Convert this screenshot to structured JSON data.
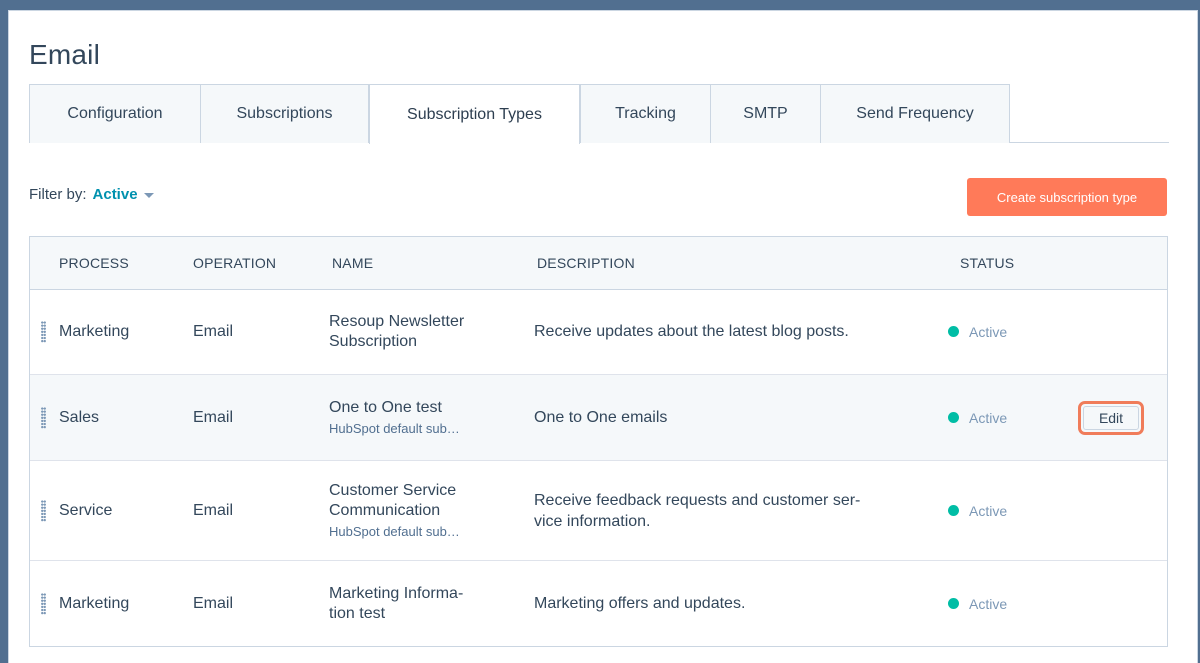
{
  "page": {
    "title": "Email"
  },
  "tabs": [
    {
      "label": "Configuration"
    },
    {
      "label": "Subscriptions"
    },
    {
      "label": "Subscription Types"
    },
    {
      "label": "Tracking"
    },
    {
      "label": "SMTP"
    },
    {
      "label": "Send Frequency"
    }
  ],
  "active_tab": "Subscription Types",
  "filter": {
    "label": "Filter by:",
    "value": "Active"
  },
  "actions": {
    "create_label": "Create subscription type"
  },
  "table": {
    "columns": [
      "PROCESS",
      "OPERATION",
      "NAME",
      "DESCRIPTION",
      "STATUS"
    ],
    "rows": [
      {
        "process": "Marketing",
        "operation": "Email",
        "name": "Resoup Newsletter Subscription",
        "subtitle": "",
        "description": "Receive updates about the latest blog posts.",
        "status": "Active"
      },
      {
        "process": "Sales",
        "operation": "Email",
        "name": "One to One test",
        "subtitle": "HubSpot default sub…",
        "description": "One to One emails",
        "status": "Active",
        "edit_label": "Edit"
      },
      {
        "process": "Service",
        "operation": "Email",
        "name": "Customer Service Communication",
        "subtitle": "HubSpot default sub…",
        "description": "Receive feedback requests and customer ser-vice information.",
        "status": "Active"
      },
      {
        "process": "Marketing",
        "operation": "Email",
        "name": "Marketing Informa-tion test",
        "subtitle": "",
        "description": "Marketing offers and updates.",
        "status": "Active"
      }
    ]
  },
  "colors": {
    "accent": "#0091ae",
    "primary_button": "#ff7a59",
    "status_active": "#00bda5",
    "highlight": "#f07c5a"
  },
  "icons": {
    "drag": "drag-handle-icon",
    "caret": "caret-down-icon",
    "status": "status-dot-icon"
  }
}
